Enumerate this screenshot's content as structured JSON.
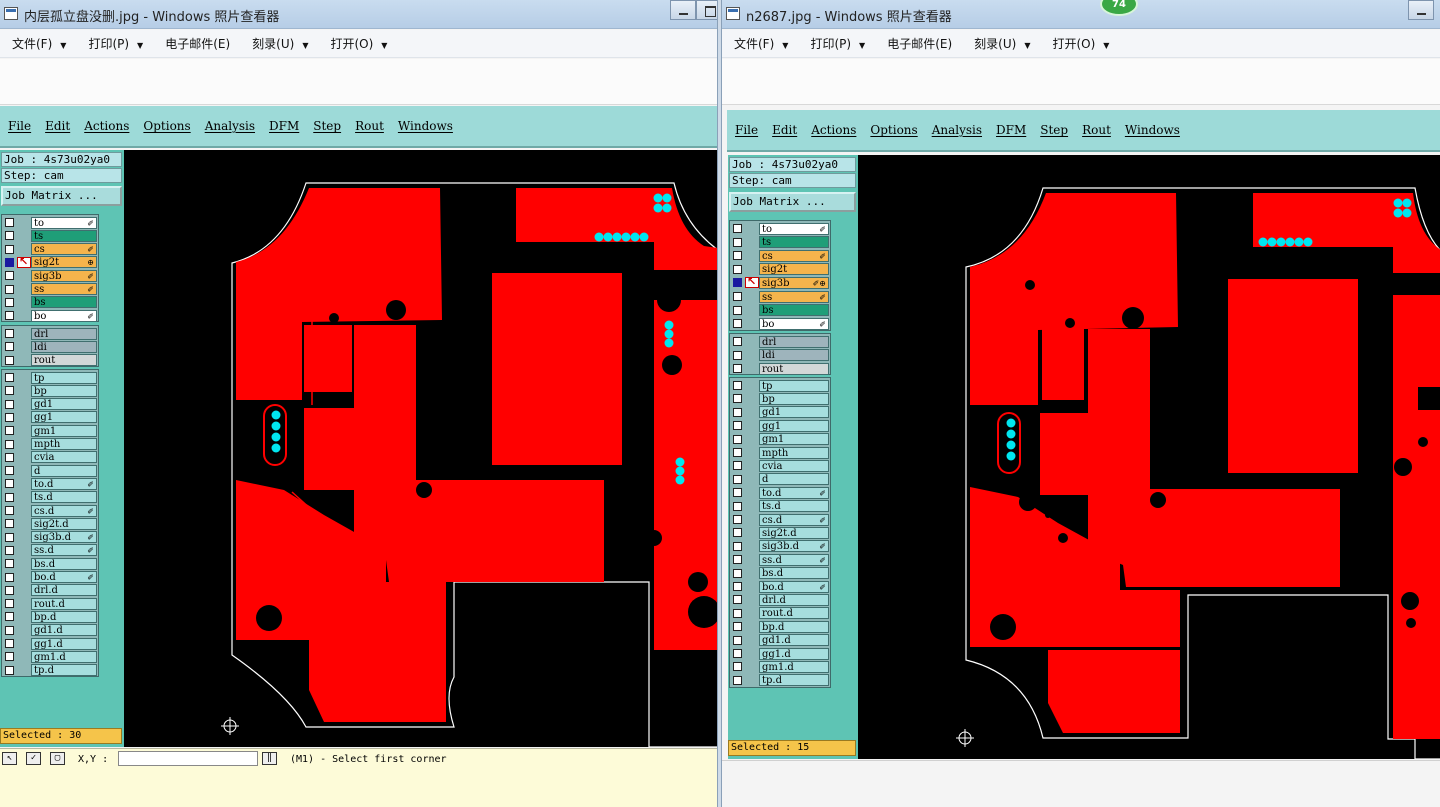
{
  "badge": "74",
  "windows": [
    {
      "title": "内层孤立盘没删.jpg - Windows 照片查看器",
      "menu": [
        {
          "label": "文件(F)",
          "dropdown": true
        },
        {
          "label": "打印(P)",
          "dropdown": true
        },
        {
          "label": "电子邮件(E)",
          "dropdown": false
        },
        {
          "label": "刻录(U)",
          "dropdown": true
        },
        {
          "label": "打开(O)",
          "dropdown": true
        }
      ],
      "genesis_menu": [
        "File",
        "Edit",
        "Actions",
        "Options",
        "Analysis",
        "DFM",
        "Step",
        "Rout",
        "Windows"
      ],
      "job": "Job : 4s73u02ya0",
      "step": "Step: cam",
      "job_matrix": "Job Matrix ...",
      "layer_groups": [
        [
          {
            "name": "to",
            "color": "white",
            "mark": "✐"
          },
          {
            "name": "ts",
            "color": "green",
            "mark": ""
          },
          {
            "name": "cs",
            "color": "orange",
            "mark": "✐"
          },
          {
            "name": "sig2t",
            "color": "orange",
            "mark": "⊕",
            "active": true
          },
          {
            "name": "sig3b",
            "color": "orange",
            "mark": "✐"
          },
          {
            "name": "ss",
            "color": "orange",
            "mark": "✐"
          },
          {
            "name": "bs",
            "color": "green",
            "mark": ""
          },
          {
            "name": "bo",
            "color": "white",
            "mark": "✐"
          }
        ],
        [
          {
            "name": "drl",
            "color": "gray",
            "mark": ""
          },
          {
            "name": "ldi",
            "color": "gray",
            "mark": ""
          },
          {
            "name": "rout",
            "color": "lgray",
            "mark": ""
          }
        ],
        [
          {
            "name": "tp",
            "color": "cyan",
            "mark": ""
          },
          {
            "name": "bp",
            "color": "cyan",
            "mark": ""
          },
          {
            "name": "gd1",
            "color": "cyan",
            "mark": ""
          },
          {
            "name": "gg1",
            "color": "cyan",
            "mark": ""
          },
          {
            "name": "gm1",
            "color": "cyan",
            "mark": ""
          },
          {
            "name": "mpth",
            "color": "cyan",
            "mark": ""
          },
          {
            "name": "cvia",
            "color": "cyan",
            "mark": ""
          },
          {
            "name": "d",
            "color": "cyan",
            "mark": ""
          },
          {
            "name": "to.d",
            "color": "cyan",
            "mark": "✐"
          },
          {
            "name": "ts.d",
            "color": "cyan",
            "mark": ""
          },
          {
            "name": "cs.d",
            "color": "cyan",
            "mark": "✐"
          },
          {
            "name": "sig2t.d",
            "color": "cyan",
            "mark": ""
          },
          {
            "name": "sig3b.d",
            "color": "cyan",
            "mark": "✐"
          },
          {
            "name": "ss.d",
            "color": "cyan",
            "mark": "✐"
          },
          {
            "name": "bs.d",
            "color": "cyan",
            "mark": ""
          },
          {
            "name": "bo.d",
            "color": "cyan",
            "mark": "✐"
          },
          {
            "name": "drl.d",
            "color": "cyan",
            "mark": ""
          },
          {
            "name": "rout.d",
            "color": "cyan",
            "mark": ""
          },
          {
            "name": "bp.d",
            "color": "cyan",
            "mark": ""
          },
          {
            "name": "gd1.d",
            "color": "cyan",
            "mark": ""
          },
          {
            "name": "gg1.d",
            "color": "cyan",
            "mark": ""
          },
          {
            "name": "gm1.d",
            "color": "cyan",
            "mark": ""
          },
          {
            "name": "tp.d",
            "color": "cyan",
            "mark": ""
          }
        ]
      ],
      "selected": "Selected : 30",
      "status": {
        "xy_label": "X,Y :",
        "prompt": "(M1) - Select first corner"
      }
    },
    {
      "title": "n2687.jpg - Windows 照片查看器",
      "menu": [
        {
          "label": "文件(F)",
          "dropdown": true
        },
        {
          "label": "打印(P)",
          "dropdown": true
        },
        {
          "label": "电子邮件(E)",
          "dropdown": false
        },
        {
          "label": "刻录(U)",
          "dropdown": true
        },
        {
          "label": "打开(O)",
          "dropdown": true
        }
      ],
      "genesis_menu": [
        "File",
        "Edit",
        "Actions",
        "Options",
        "Analysis",
        "DFM",
        "Step",
        "Rout",
        "Windows"
      ],
      "job": "Job : 4s73u02ya0",
      "step": "Step: cam",
      "job_matrix": "Job Matrix ...",
      "layer_groups": [
        [
          {
            "name": "to",
            "color": "white",
            "mark": "✐"
          },
          {
            "name": "ts",
            "color": "green",
            "mark": ""
          },
          {
            "name": "cs",
            "color": "orange",
            "mark": "✐"
          },
          {
            "name": "sig2t",
            "color": "orange",
            "mark": ""
          },
          {
            "name": "sig3b",
            "color": "orange",
            "mark": "✐⊕",
            "active": true
          },
          {
            "name": "ss",
            "color": "orange",
            "mark": "✐"
          },
          {
            "name": "bs",
            "color": "green",
            "mark": ""
          },
          {
            "name": "bo",
            "color": "white",
            "mark": "✐"
          }
        ],
        [
          {
            "name": "drl",
            "color": "gray",
            "mark": ""
          },
          {
            "name": "ldi",
            "color": "gray",
            "mark": ""
          },
          {
            "name": "rout",
            "color": "lgray",
            "mark": ""
          }
        ],
        [
          {
            "name": "tp",
            "color": "cyan",
            "mark": ""
          },
          {
            "name": "bp",
            "color": "cyan",
            "mark": ""
          },
          {
            "name": "gd1",
            "color": "cyan",
            "mark": ""
          },
          {
            "name": "gg1",
            "color": "cyan",
            "mark": ""
          },
          {
            "name": "gm1",
            "color": "cyan",
            "mark": ""
          },
          {
            "name": "mpth",
            "color": "cyan",
            "mark": ""
          },
          {
            "name": "cvia",
            "color": "cyan",
            "mark": ""
          },
          {
            "name": "d",
            "color": "cyan",
            "mark": ""
          },
          {
            "name": "to.d",
            "color": "cyan",
            "mark": "✐"
          },
          {
            "name": "ts.d",
            "color": "cyan",
            "mark": ""
          },
          {
            "name": "cs.d",
            "color": "cyan",
            "mark": "✐"
          },
          {
            "name": "sig2t.d",
            "color": "cyan",
            "mark": ""
          },
          {
            "name": "sig3b.d",
            "color": "cyan",
            "mark": "✐"
          },
          {
            "name": "ss.d",
            "color": "cyan",
            "mark": "✐"
          },
          {
            "name": "bs.d",
            "color": "cyan",
            "mark": ""
          },
          {
            "name": "bo.d",
            "color": "cyan",
            "mark": "✐"
          },
          {
            "name": "drl.d",
            "color": "cyan",
            "mark": ""
          },
          {
            "name": "rout.d",
            "color": "cyan",
            "mark": ""
          },
          {
            "name": "bp.d",
            "color": "cyan",
            "mark": ""
          },
          {
            "name": "gd1.d",
            "color": "cyan",
            "mark": ""
          },
          {
            "name": "gg1.d",
            "color": "cyan",
            "mark": ""
          },
          {
            "name": "gm1.d",
            "color": "cyan",
            "mark": ""
          },
          {
            "name": "tp.d",
            "color": "cyan",
            "mark": ""
          }
        ]
      ],
      "selected": "Selected : 15"
    }
  ],
  "colors": {
    "copper": "#ff0000",
    "pad": "#00e6f0",
    "board": "#000000",
    "outline": "#ffffff",
    "panel": "#5ec4b4",
    "menu": "#9ddad8"
  }
}
